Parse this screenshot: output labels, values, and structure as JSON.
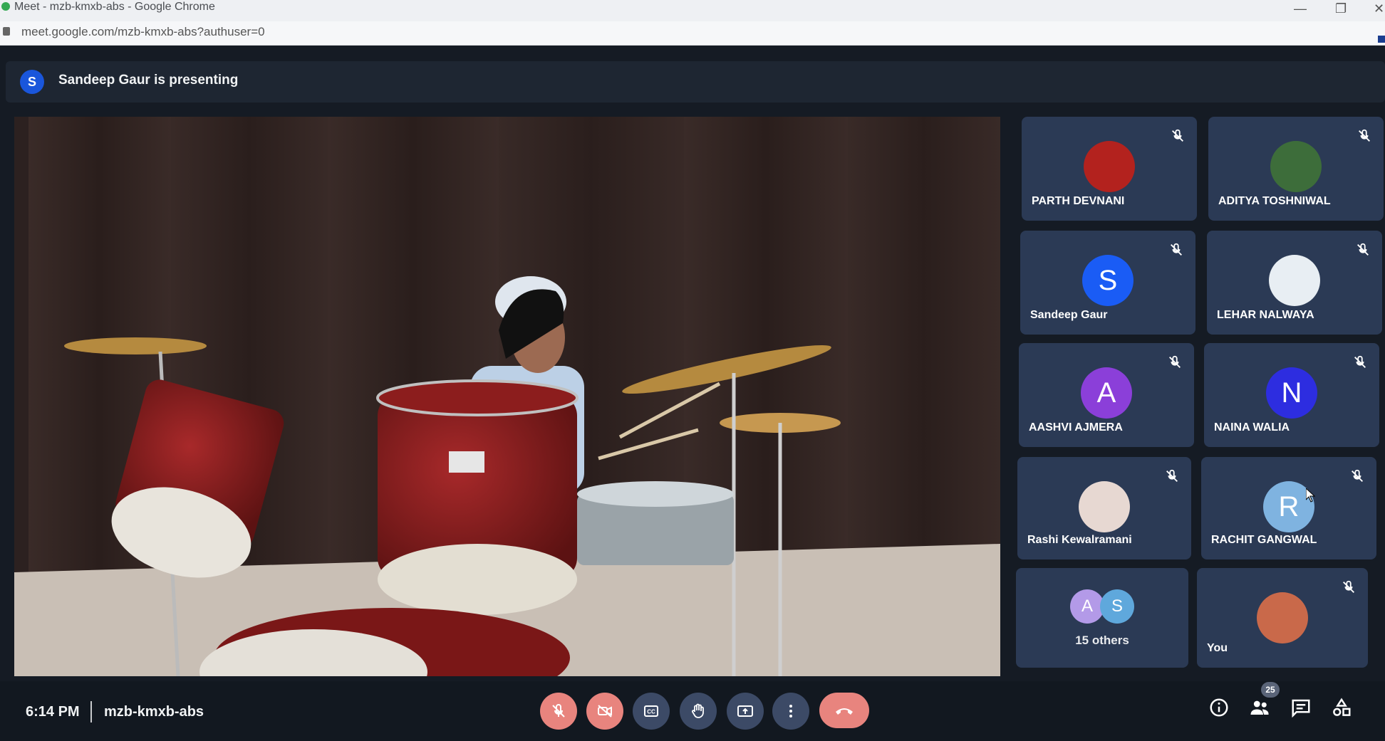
{
  "window": {
    "title": "Meet - mzb-kmxb-abs - Google Chrome",
    "url": "meet.google.com/mzb-kmxb-abs?authuser=0"
  },
  "presenter": {
    "initial": "S",
    "text": "Sandeep Gaur is presenting"
  },
  "participants": [
    {
      "name": "PARTH DEVNANI",
      "avatar": "photo",
      "muted": true
    },
    {
      "name": "ADITYA TOSHNIWAL",
      "avatar": "photo",
      "muted": true
    },
    {
      "name": "Sandeep Gaur",
      "avatar": "S",
      "color": "#1a5cf5",
      "muted": true
    },
    {
      "name": "LEHAR NALWAYA",
      "avatar": "photo",
      "muted": true
    },
    {
      "name": "AASHVI AJMERA",
      "avatar": "A",
      "color": "#8b3fd9",
      "muted": true
    },
    {
      "name": "NAINA WALIA",
      "avatar": "N",
      "color": "#2d2de0",
      "muted": true
    },
    {
      "name": "Rashi Kewalramani",
      "avatar": "photo",
      "muted": true
    },
    {
      "name": "RACHIT GANGWAL",
      "avatar": "R",
      "color": "#7fb3e0",
      "muted": true
    },
    {
      "name": "You",
      "avatar": "photo",
      "muted": true
    }
  ],
  "others": {
    "initials": [
      "A",
      "S"
    ],
    "count_label": "15 others"
  },
  "bottom_bar": {
    "time": "6:14 PM",
    "meeting_code": "mzb-kmxb-abs",
    "participant_count": "25"
  },
  "colors": {
    "tile_bg": "#2b3a55",
    "control_bg": "#3c4a66",
    "danger": "#e8847e"
  }
}
